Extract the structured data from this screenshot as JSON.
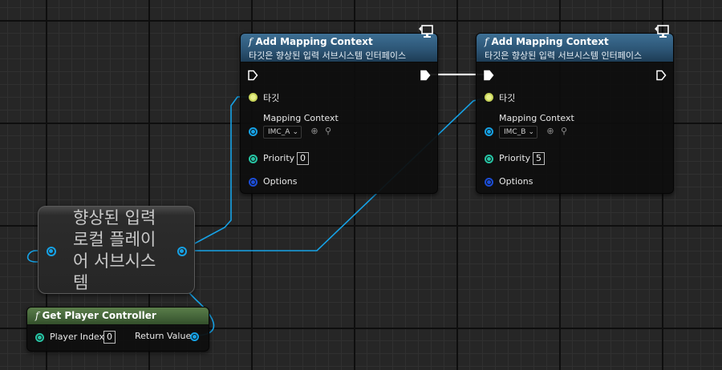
{
  "colors": {
    "exec": "#ffffff",
    "object_wire": "#16a2e6",
    "target_pin": "#e6f08a",
    "int_pin": "#27c4a4",
    "struct_pin": "#1c4dd6",
    "function_header": "#2d5676",
    "pure_header": "#45653a"
  },
  "nodes": {
    "add_mapping_a": {
      "title": "Add Mapping Context",
      "subtitle": "타깃은 향상된 입력 서브시스템 인터페이스",
      "target_label": "타깃",
      "mapping_label": "Mapping Context",
      "mapping_value": "IMC_A",
      "priority_label": "Priority",
      "priority_value": "0",
      "options_label": "Options",
      "icon": "monitor-icon"
    },
    "add_mapping_b": {
      "title": "Add Mapping Context",
      "subtitle": "타깃은 향상된 입력 서브시스템 인터페이스",
      "target_label": "타깃",
      "mapping_label": "Mapping Context",
      "mapping_value": "IMC_B",
      "priority_label": "Priority",
      "priority_value": "5",
      "options_label": "Options",
      "icon": "monitor-icon"
    },
    "subsystem": {
      "label": "향상된 입력 로컬 플레이어 서브시스템"
    },
    "get_player_controller": {
      "title": "Get Player Controller",
      "player_index_label": "Player Index",
      "player_index_value": "0",
      "return_label": "Return Value"
    }
  }
}
